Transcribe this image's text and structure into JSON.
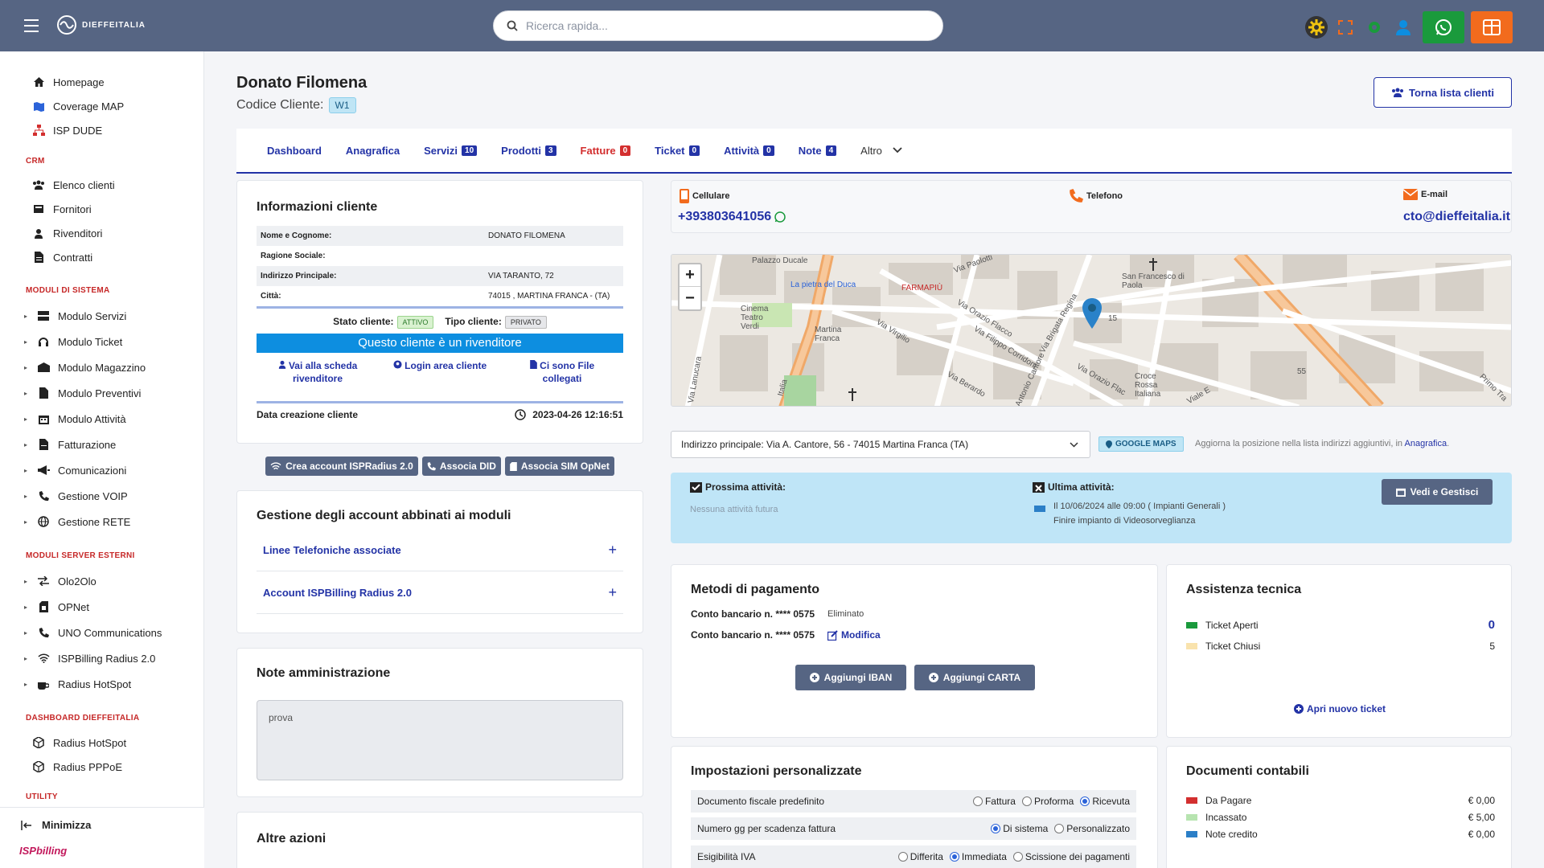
{
  "header": {
    "logo_text": "DIEFFEITALIA",
    "search_placeholder": "Ricerca rapida..."
  },
  "sidebar": {
    "top_items": [
      {
        "label": "Homepage",
        "icon": "home-icon"
      },
      {
        "label": "Coverage MAP",
        "icon": "map-icon"
      },
      {
        "label": "ISP DUDE",
        "icon": "network-icon"
      }
    ],
    "sections": {
      "crm": "CRM",
      "moduli_sistema": "MODULI DI SISTEMA",
      "moduli_esterni": "MODULI SERVER ESTERNI",
      "dashboard": "DASHBOARD DIEFFEITALIA",
      "utility": "UTILITY"
    },
    "crm_items": [
      "Elenco clienti",
      "Fornitori",
      "Rivenditori",
      "Contratti"
    ],
    "sistema_items": [
      "Modulo Servizi",
      "Modulo Ticket",
      "Modulo Magazzino",
      "Modulo Preventivi",
      "Modulo Attività",
      "Fatturazione",
      "Comunicazioni",
      "Gestione VOIP",
      "Gestione RETE"
    ],
    "esterni_items": [
      "Olo2Olo",
      "OPNet",
      "UNO Communications",
      "ISPBilling Radius 2.0",
      "Radius HotSpot"
    ],
    "dashboard_items": [
      "Radius HotSpot",
      "Radius PPPoE"
    ],
    "minimize_label": "Minimizza",
    "brand": "ISPbilling"
  },
  "client": {
    "name": "Donato Filomena",
    "code_label": "Codice Cliente:",
    "code": "W1",
    "back_button": "Torna lista clienti"
  },
  "tabs": [
    {
      "label": "Dashboard",
      "count": null
    },
    {
      "label": "Anagrafica",
      "count": null
    },
    {
      "label": "Servizi",
      "count": "10"
    },
    {
      "label": "Prodotti",
      "count": "3"
    },
    {
      "label": "Fatture",
      "count": "0"
    },
    {
      "label": "Ticket",
      "count": "0"
    },
    {
      "label": "Attività",
      "count": "0"
    },
    {
      "label": "Note",
      "count": "4"
    },
    {
      "label": "Altro",
      "count": null
    }
  ],
  "info": {
    "title": "Informazioni cliente",
    "rows": [
      {
        "k": "Nome e Cognome:",
        "v": "DONATO FILOMENA"
      },
      {
        "k": "Ragione Sociale:",
        "v": ""
      },
      {
        "k": "Indirizzo Principale:",
        "v": "VIA TARANTO, 72"
      },
      {
        "k": "Città:",
        "v": "74015 , MARTINA FRANCA - (TA)"
      }
    ],
    "stato_label": "Stato cliente:",
    "stato_value": "ATTIVO",
    "tipo_label": "Tipo cliente:",
    "tipo_value": "PRIVATO",
    "reseller_banner": "Questo cliente è un rivenditore",
    "link_scheda": "Vai alla scheda rivenditore",
    "link_login": "Login area cliente",
    "link_file": "Ci sono File collegati",
    "data_label": "Data creazione cliente",
    "data_value": "2023-04-26 12:16:51"
  },
  "actions": {
    "crea_radius": "Crea account ISPRadius 2.0",
    "associa_did": "Associa DID",
    "associa_sim": "Associa SIM OpNet"
  },
  "accounts": {
    "title": "Gestione degli account abbinati ai moduli",
    "linee": "Linee Telefoniche associate",
    "radius": "Account ISPBilling Radius 2.0"
  },
  "note_admin": {
    "title": "Note amministrazione",
    "value": "prova"
  },
  "altre_azioni": {
    "title": "Altre azioni"
  },
  "contacts": {
    "cell_label": "Cellulare",
    "cell_value": "+393803641056",
    "tel_label": "Telefono",
    "email_label": "E-mail",
    "email_value": "cto@dieffeitalia.it"
  },
  "map_labels": {
    "pietra": "La pietra del Duca",
    "palazzo": "Palazzo Ducale",
    "farmapiu": "FARMAPIÙ",
    "cinema": "Cinema Teatro Verdi",
    "martina": "Martina Franca",
    "sanfrancesco": "San Francesco di Paola",
    "croce": "Croce Rossa Italiana",
    "via_paolotti": "Via Paolotti",
    "via_virgilio": "Via Virgilio",
    "via_orazio": "Via Orazio Flacco",
    "via_filippo": "Via Filippo Corridoni",
    "via_brigata": "Via Brigata Regina",
    "via_lanucara": "Via Lanucara",
    "via_italia": "Italia",
    "via_cantore": "Antonio Cantore",
    "via_orazio2": "Via Orazio Flac",
    "via_berardo": "Via Berardo",
    "viale": "Viale E",
    "primo": "Primo Tra",
    "num55": "55",
    "num15": "15"
  },
  "address": {
    "selected": "Indirizzo principale: Via A. Cantore, 56 - 74015 Martina Franca (TA)",
    "gmaps": "GOOGLE MAPS",
    "hint": "Aggiorna la posizione nella lista indirizzi aggiuntivi, in",
    "hint_link": "Anagrafica"
  },
  "attivita": {
    "next_title": "Prossima attività:",
    "next_text": "Nessuna attività futura",
    "last_title": "Ultima attività:",
    "last_line1": "Il 10/06/2024 alle 09:00 ( Impianti Generali )",
    "last_line2": "Finire impianto di Videosorveglianza",
    "button": "Vedi e Gestisci"
  },
  "pagamento": {
    "title": "Metodi di pagamento",
    "row1": "Conto bancario n. **** 0575",
    "row1_tag": "Eliminato",
    "row2": "Conto bancario n. **** 0575",
    "row2_link": "Modifica",
    "btn_iban": "Aggiungi IBAN",
    "btn_carta": "Aggiungi CARTA"
  },
  "assistenza": {
    "title": "Assistenza tecnica",
    "aperti_label": "Ticket Aperti",
    "aperti_value": "0",
    "chiusi_label": "Ticket Chiusi",
    "chiusi_value": "5",
    "apri": "Apri nuovo ticket"
  },
  "impostazioni": {
    "title": "Impostazioni personalizzate",
    "row1_label": "Documento fiscale predefinito",
    "row1_opts": [
      "Fattura",
      "Proforma",
      "Ricevuta"
    ],
    "row2_label": "Numero gg per scadenza fattura",
    "row2_opts": [
      "Di sistema",
      "Personalizzato"
    ],
    "row3_label": "Esigibilità IVA",
    "row3_opts": [
      "Differita",
      "Immediata",
      "Scissione dei pagamenti"
    ]
  },
  "documenti": {
    "title": "Documenti contabili",
    "rows": [
      {
        "label": "Da Pagare",
        "value": "€ 0,00"
      },
      {
        "label": "Incassato",
        "value": "€ 5,00"
      },
      {
        "label": "Note credito",
        "value": "€ 0,00"
      }
    ]
  },
  "colors": {
    "header_bg": "#566583",
    "accent": "#2333a6",
    "danger": "#d32f2f",
    "info": "#0d8ee0",
    "whatsapp": "#1a9a3c",
    "orange": "#f26b1d"
  }
}
